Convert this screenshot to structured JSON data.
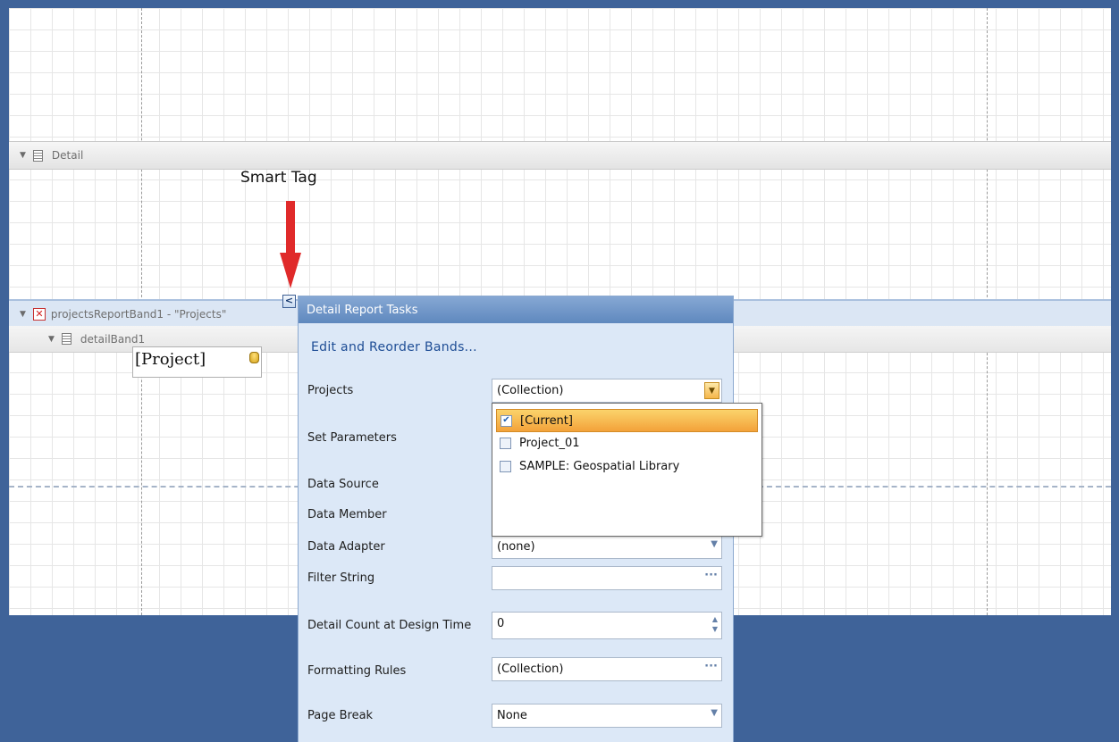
{
  "bands": {
    "detail": "Detail",
    "projects_band": "projectsReportBand1 - \"Projects\"",
    "detail_band": "detailBand1"
  },
  "field": {
    "text": "[Project]"
  },
  "annotation": {
    "label": "Smart Tag",
    "arrow_color": "#e02a2a"
  },
  "smart_tag": {
    "glyph": "<"
  },
  "panel": {
    "title": "Detail Report Tasks",
    "edit_link": "Edit and Reorder Bands...",
    "properties": {
      "projects": {
        "label": "Projects",
        "value": "(Collection)"
      },
      "set_parameters": {
        "label": "Set Parameters"
      },
      "data_source": {
        "label": "Data Source"
      },
      "data_member": {
        "label": "Data Member"
      },
      "data_adapter": {
        "label": "Data Adapter",
        "value": "(none)"
      },
      "filter_string": {
        "label": "Filter String",
        "value": ""
      },
      "detail_count": {
        "label": "Detail Count at Design Time",
        "value": "0"
      },
      "formatting_rules": {
        "label": "Formatting Rules",
        "value": "(Collection)"
      },
      "page_break": {
        "label": "Page Break",
        "value": "None"
      }
    }
  },
  "dropdown": {
    "options": [
      {
        "label": "[Current]",
        "checked": true
      },
      {
        "label": "Project_01",
        "checked": false
      },
      {
        "label": "SAMPLE: Geospatial Library",
        "checked": false
      }
    ]
  }
}
